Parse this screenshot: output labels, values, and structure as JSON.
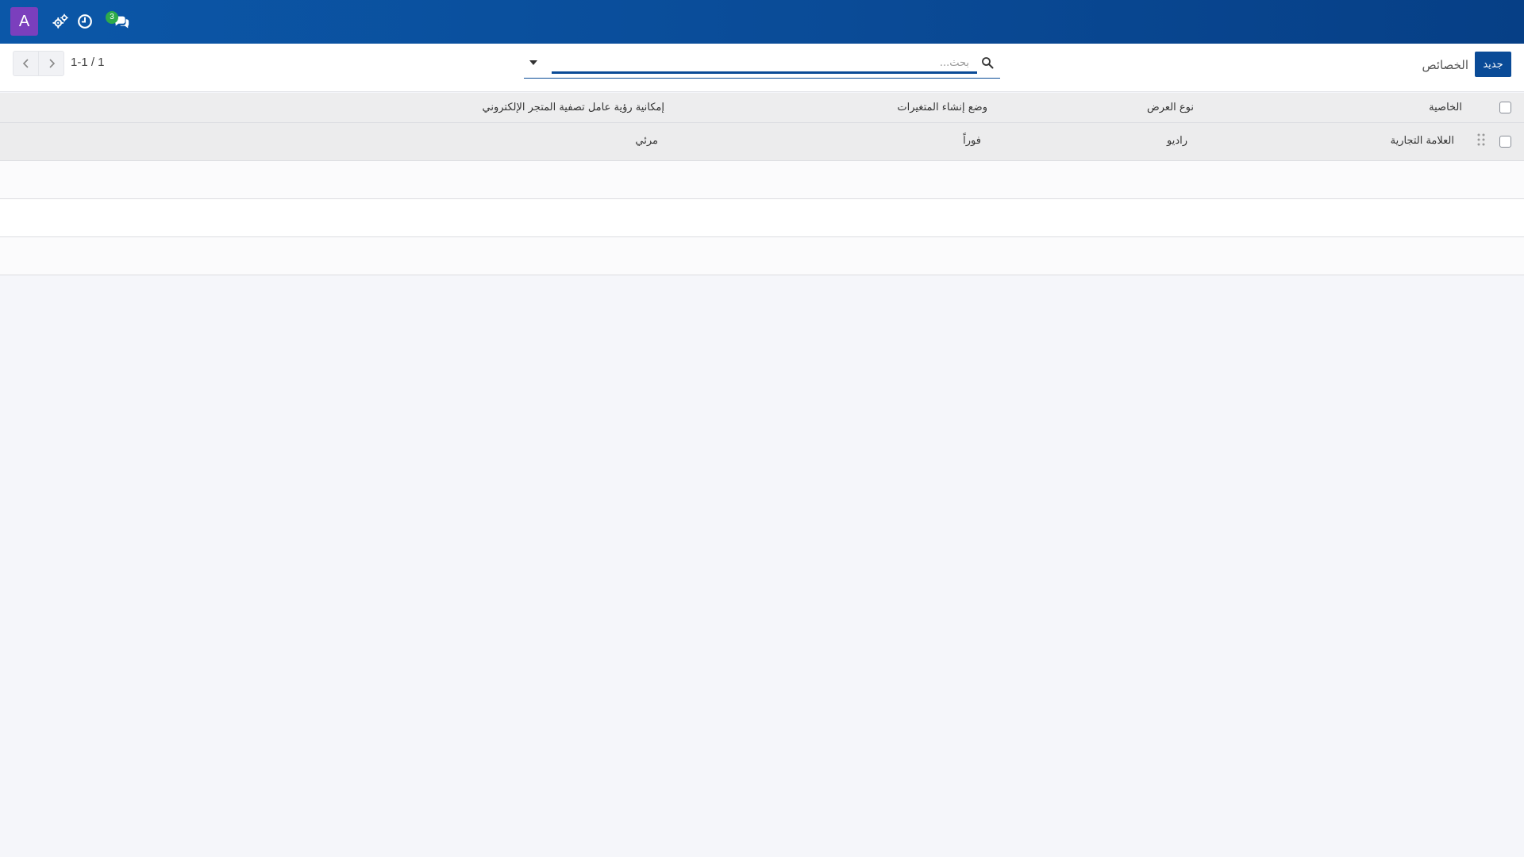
{
  "topbar": {
    "avatar_letter": "A",
    "chat_badge": "3",
    "icons": [
      "gear-cluster-icon",
      "clock-icon",
      "chat-bubbles-icon"
    ],
    "colors": {
      "bar": "#0a4b97",
      "avatar": "#7b3fbd",
      "badge": "#2eaa4a"
    }
  },
  "controlbar": {
    "new_label": "جديد",
    "breadcrumb": "الخصائص",
    "search_placeholder": "بحث...",
    "pager": "1-1 / 1"
  },
  "table": {
    "headers": {
      "attribute": "الخاصية",
      "display_type": "نوع العرض",
      "variant_mode": "وضع إنشاء المتغيرات",
      "visibility": "إمكانية رؤية عامل تصفية المتجر الإلكتروني"
    },
    "rows": [
      {
        "attribute": "العلامة التجارية",
        "display_type": "راديو",
        "variant_mode": "فوراً",
        "visibility": "مرئي"
      }
    ]
  }
}
